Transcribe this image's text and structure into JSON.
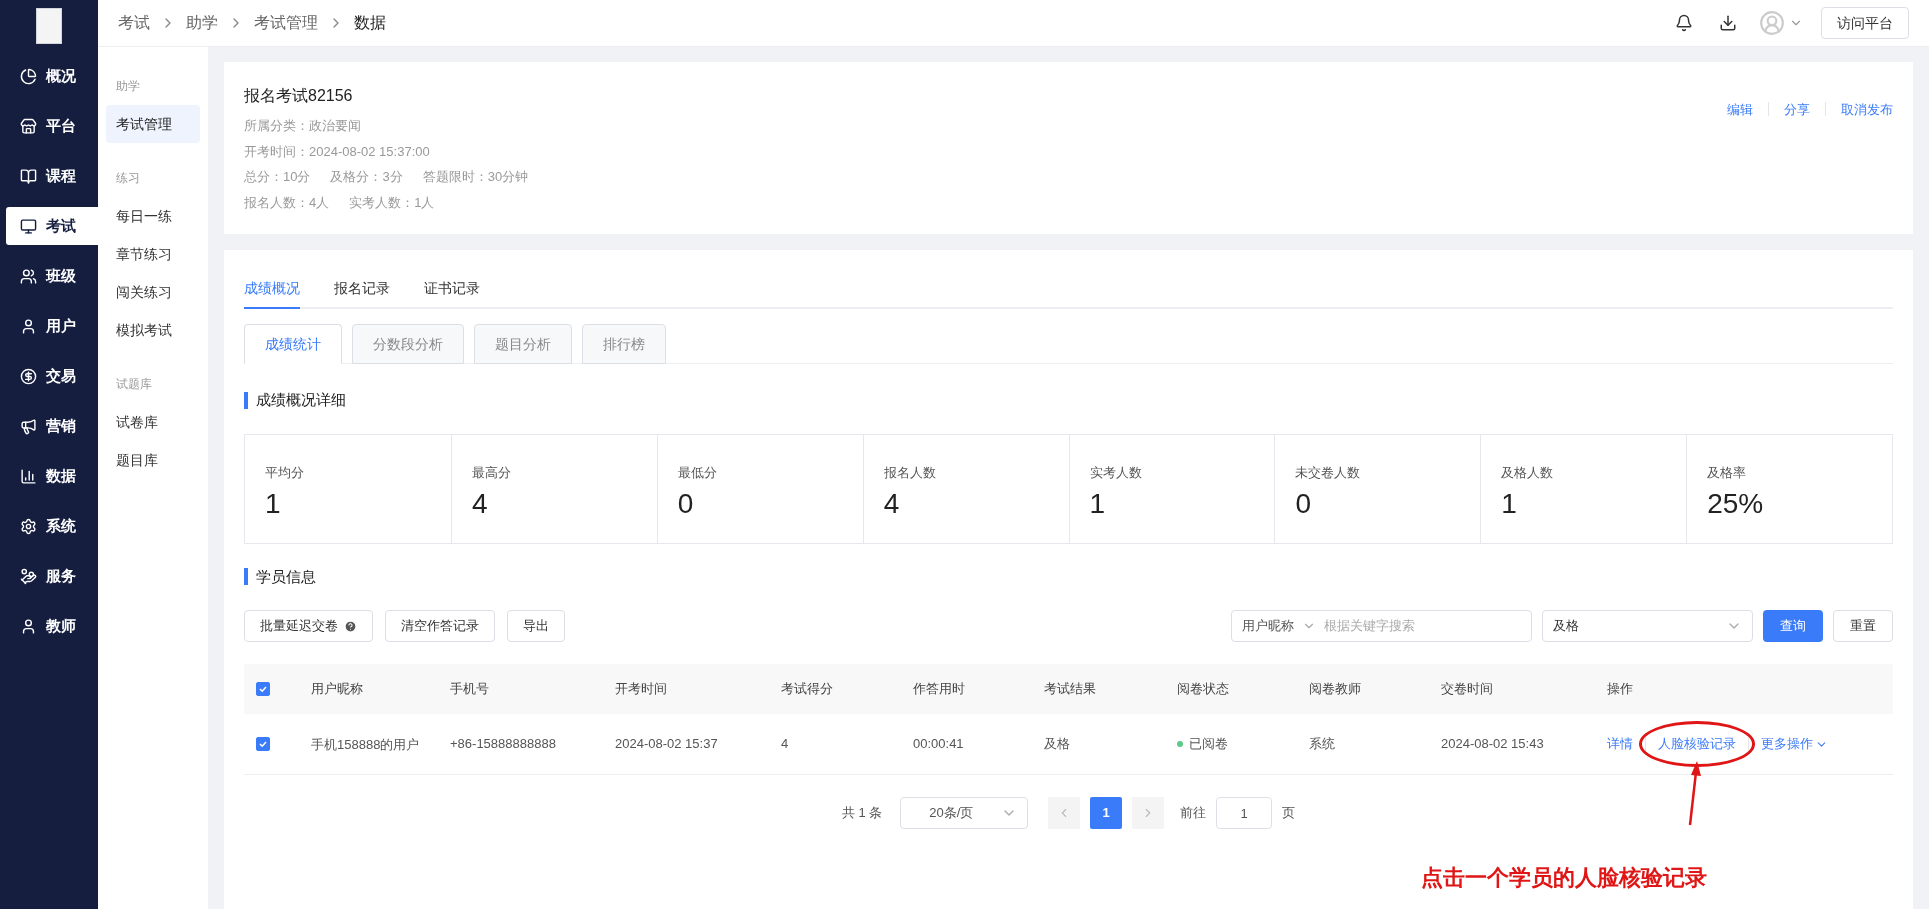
{
  "sidebar": {
    "items": [
      {
        "label": "概况",
        "selected": false
      },
      {
        "label": "平台",
        "selected": false
      },
      {
        "label": "课程",
        "selected": false
      },
      {
        "label": "考试",
        "selected": true
      },
      {
        "label": "班级",
        "selected": false
      },
      {
        "label": "用户",
        "selected": false
      },
      {
        "label": "交易",
        "selected": false
      },
      {
        "label": "营销",
        "selected": false
      },
      {
        "label": "数据",
        "selected": false
      },
      {
        "label": "系统",
        "selected": false
      },
      {
        "label": "服务",
        "selected": false
      },
      {
        "label": "教师",
        "selected": false
      }
    ]
  },
  "breadcrumb": [
    "考试",
    "助学",
    "考试管理",
    "数据"
  ],
  "header": {
    "button": "访问平台"
  },
  "subnav": {
    "groups": [
      {
        "title": "助学",
        "items": [
          {
            "label": "考试管理",
            "selected": true
          }
        ]
      },
      {
        "title": "练习",
        "items": [
          {
            "label": "每日一练",
            "selected": false
          },
          {
            "label": "章节练习",
            "selected": false
          },
          {
            "label": "闯关练习",
            "selected": false
          },
          {
            "label": "模拟考试",
            "selected": false
          }
        ]
      },
      {
        "title": "试题库",
        "items": [
          {
            "label": "试卷库",
            "selected": false
          },
          {
            "label": "题目库",
            "selected": false
          }
        ]
      }
    ]
  },
  "exam": {
    "title": "报名考试82156",
    "lines": [
      [
        "所属分类：政治要闻"
      ],
      [
        "开考时间：2024-08-02 15:37:00"
      ],
      [
        "总分：10分",
        "及格分：3分",
        "答题限时：30分钟"
      ],
      [
        "报名人数：4人",
        "实考人数：1人"
      ]
    ],
    "actions": [
      "编辑",
      "分享",
      "取消发布"
    ]
  },
  "tabs": [
    {
      "label": "成绩概况",
      "selected": true
    },
    {
      "label": "报名记录",
      "selected": false
    },
    {
      "label": "证书记录",
      "selected": false
    }
  ],
  "subtabs": [
    {
      "label": "成绩统计",
      "selected": true
    },
    {
      "label": "分数段分析",
      "selected": false
    },
    {
      "label": "题目分析",
      "selected": false
    },
    {
      "label": "排行榜",
      "selected": false
    }
  ],
  "section_stats": "成绩概况详细",
  "stats": [
    {
      "label": "平均分",
      "value": "1"
    },
    {
      "label": "最高分",
      "value": "4"
    },
    {
      "label": "最低分",
      "value": "0"
    },
    {
      "label": "报名人数",
      "value": "4"
    },
    {
      "label": "实考人数",
      "value": "1"
    },
    {
      "label": "未交卷人数",
      "value": "0"
    },
    {
      "label": "及格人数",
      "value": "1"
    },
    {
      "label": "及格率",
      "value": "25%"
    }
  ],
  "section_students": "学员信息",
  "toolbar": {
    "buttons": [
      {
        "label": "批量延迟交卷",
        "help": true
      },
      {
        "label": "清空作答记录",
        "help": false
      },
      {
        "label": "导出",
        "help": false
      }
    ]
  },
  "filters": {
    "field_select": "用户昵称",
    "placeholder": "根据关键字搜索",
    "result_select": "及格",
    "query": "查询",
    "reset": "重置"
  },
  "table": {
    "all_checked": true,
    "columns": [
      "用户昵称",
      "手机号",
      "开考时间",
      "考试得分",
      "作答用时",
      "考试结果",
      "阅卷状态",
      "阅卷教师",
      "交卷时间",
      "操作"
    ],
    "rows": [
      {
        "checked": true,
        "cells": [
          "手机158888的用户",
          "+86-15888888888",
          "2024-08-02 15:37",
          "4",
          "00:00:41",
          "及格"
        ],
        "status": {
          "text": "已阅卷",
          "color": "#5cc98a"
        },
        "teacher": "系统",
        "submitted": "2024-08-02 15:43",
        "actions": [
          {
            "label": "详情",
            "circled": false,
            "caret": false
          },
          {
            "label": "人脸核验记录",
            "circled": true,
            "caret": false
          },
          {
            "label": "更多操作",
            "circled": false,
            "caret": true
          }
        ]
      }
    ]
  },
  "pagination": {
    "total": "共 1 条",
    "page_size": "20条/页",
    "pages": [
      {
        "label": "1",
        "selected": true
      }
    ],
    "goto_label": "前往",
    "goto_value": "1",
    "page_unit": "页"
  },
  "annotation": {
    "text": "点击一个学员的人脸核验记录"
  }
}
